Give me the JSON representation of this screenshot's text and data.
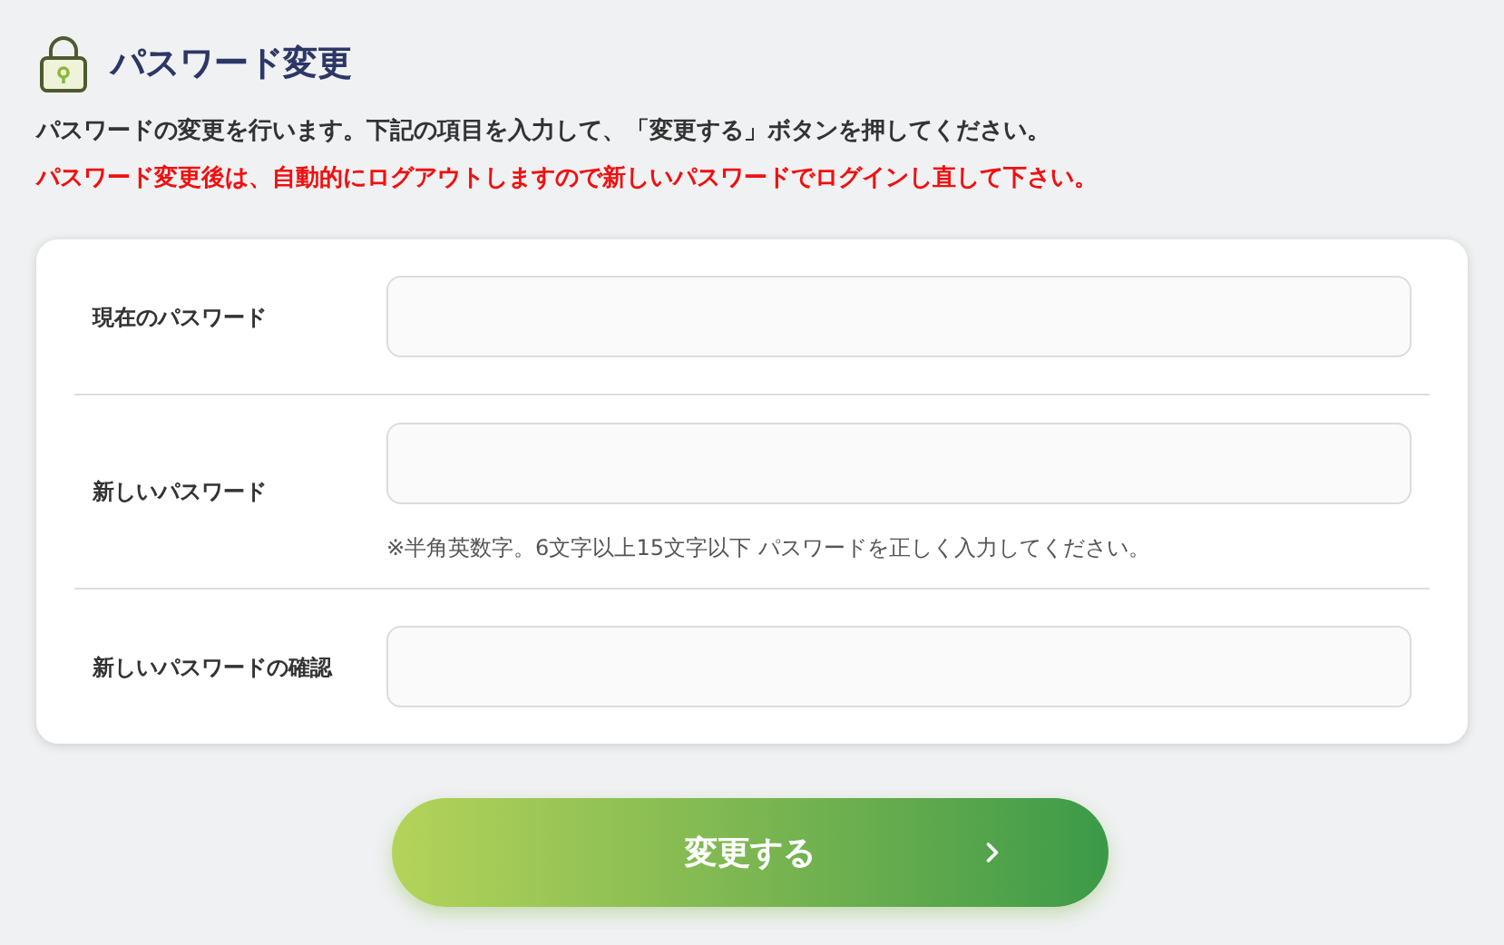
{
  "header": {
    "title": "パスワード変更"
  },
  "description": "パスワードの変更を行います。下記の項目を入力して、「変更する」ボタンを押してください。",
  "warning": "パスワード変更後は、自動的にログアウトしますので新しいパスワードでログインし直して下さい。",
  "fields": [
    {
      "label": "現在のパスワード"
    },
    {
      "label": "新しいパスワード",
      "hint": "※半角英数字。6文字以上15文字以下 パスワードを正しく入力してください。"
    },
    {
      "label": "新しいパスワードの確認"
    }
  ],
  "submit_button": {
    "label": "変更する"
  }
}
